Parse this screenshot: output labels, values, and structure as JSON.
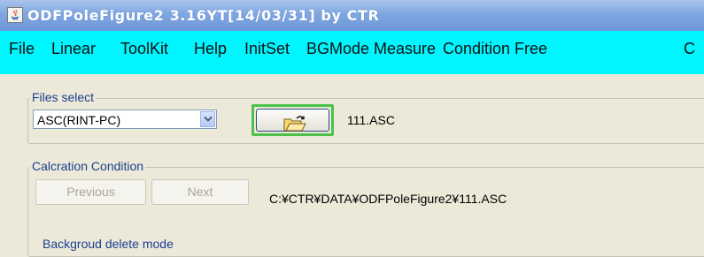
{
  "window": {
    "title": "ODFPoleFigure2 3.16YT[14/03/31] by CTR"
  },
  "menubar": {
    "items": [
      "File",
      "Linear",
      "ToolKit",
      "Help",
      "InitSet",
      "BGMode Measure",
      "Condition Free",
      "C"
    ]
  },
  "files_select": {
    "legend": "Files select",
    "format_selected": "ASC(RINT-PC)",
    "file_name": "111.ASC"
  },
  "calc_condition": {
    "legend": "Calcration Condition",
    "previous_label": "Previous",
    "next_label": "Next",
    "file_path": "C:¥CTR¥DATA¥ODFPoleFigure2¥111.ASC"
  },
  "background": {
    "label": "Backgroud delete mode"
  },
  "colors": {
    "menubar_bg": "#00f5ff",
    "highlight_border": "#4cc24c",
    "group_legend": "#1c3f94"
  }
}
